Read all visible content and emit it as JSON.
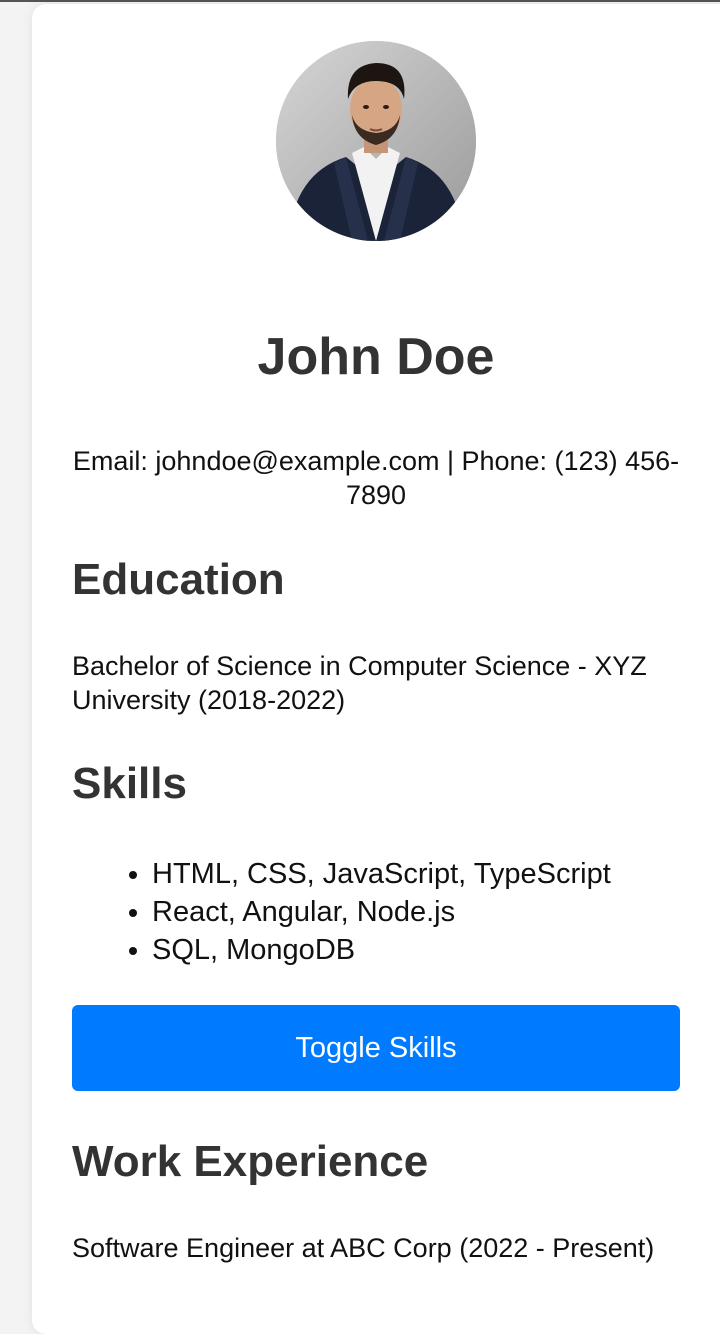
{
  "profile": {
    "photo_alt": "Profile photo of John Doe",
    "name": "John Doe",
    "contact": "Email: johndoe@example.com | Phone: (123) 456-7890"
  },
  "education": {
    "heading": "Education",
    "text": "Bachelor of Science in Computer Science - XYZ University (2018-2022)"
  },
  "skills": {
    "heading": "Skills",
    "items": [
      "HTML, CSS, JavaScript, TypeScript",
      "React, Angular, Node.js",
      "SQL, MongoDB"
    ],
    "toggle_label": "Toggle Skills"
  },
  "work": {
    "heading": "Work Experience",
    "text": "Software Engineer at ABC Corp (2022 - Present)"
  },
  "colors": {
    "accent": "#007bff",
    "heading_text": "#333333",
    "body_text": "#111111",
    "card_background": "#ffffff",
    "page_background": "#f3f3f3"
  }
}
